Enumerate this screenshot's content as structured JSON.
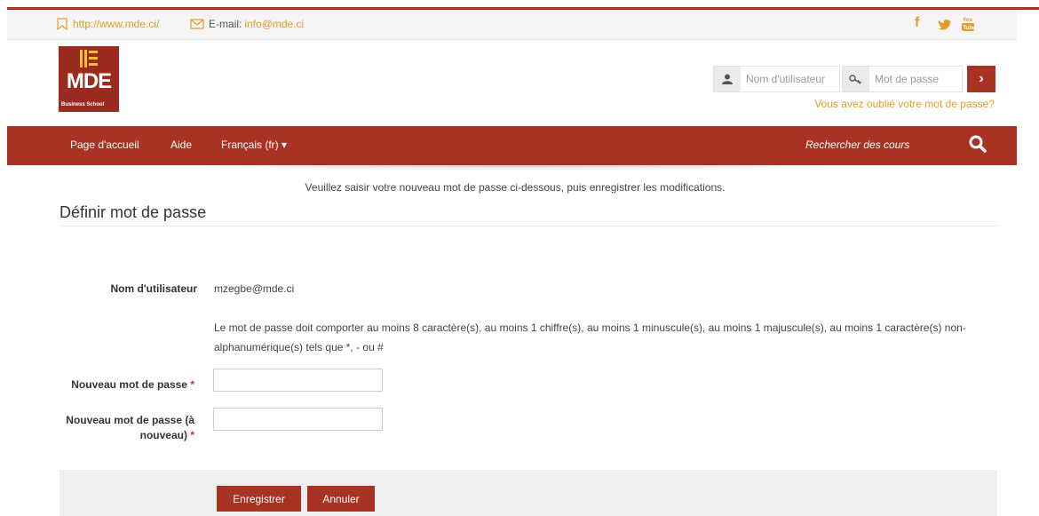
{
  "topbar": {
    "website": "http://www.mde.ci/",
    "email_label": "E-mail:",
    "email": "info@mde.ci",
    "social": [
      "facebook-icon",
      "twitter-icon",
      "youtube-icon"
    ]
  },
  "header": {
    "logo_text": "MDE",
    "logo_subtext": "Business School",
    "username_placeholder": "Nom d'utilisateur",
    "password_placeholder": "Mot de passe",
    "forgot_link": "Vous avez oublié votre mot de passe?"
  },
  "nav": {
    "items": [
      "Page d'accueil",
      "Aide",
      "Français (fr) ▾"
    ],
    "search_placeholder": "Rechercher des cours"
  },
  "page": {
    "instructions": "Veuillez saisir votre nouveau mot de passe ci-dessous, puis enregistrer les modifications.",
    "title": "Définir mot de passe"
  },
  "form": {
    "username_label": "Nom d'utilisateur",
    "username_value": "mzegbe@mde.ci",
    "policy_text": "Le mot de passe doit comporter au moins 8 caractère(s), au moins 1 chiffre(s), au moins 1 minuscule(s), au moins 1 majuscule(s), au moins 1 caractère(s) non-alphanumérique(s) tels que *, - ou #",
    "new_password_label": "Nouveau mot de passe",
    "new_password_again_label_line1": "Nouveau mot de passe (à",
    "new_password_again_label_line2": "nouveau)",
    "required_mark": "*",
    "save_label": "Enregistrer",
    "cancel_label": "Annuler"
  },
  "colors": {
    "brand_red": "#a83324",
    "accent_orange": "#e39b2d"
  }
}
